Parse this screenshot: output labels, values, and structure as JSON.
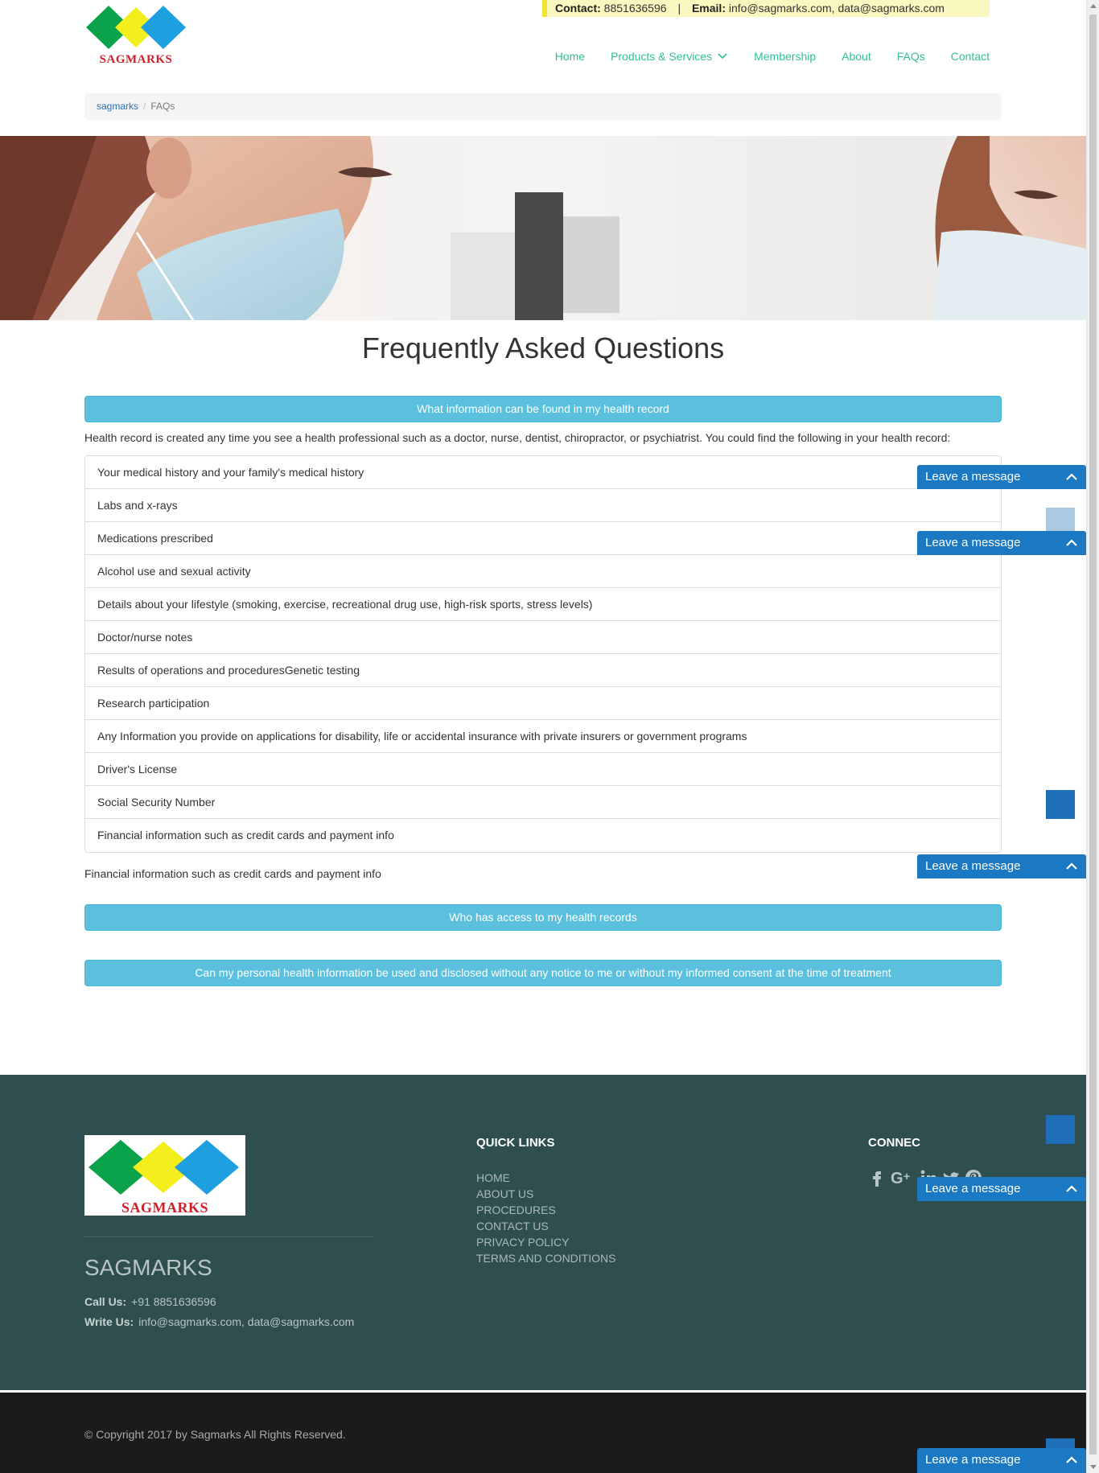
{
  "brand": {
    "logo_text": "SAGMARKS",
    "colors": {
      "green": "#0aa24a",
      "yellow": "#f4ee1c",
      "blue": "#1e9fe0",
      "red": "#d0202a"
    }
  },
  "contact_bar": {
    "contact_label": "Contact:",
    "contact_value": "8851636596",
    "separator": "|",
    "email_label": "Email:",
    "email_value": "info@sagmarks.com, data@sagmarks.com"
  },
  "nav": {
    "items": [
      {
        "label": "Home"
      },
      {
        "label": "Products & Services"
      },
      {
        "label": "Membership"
      },
      {
        "label": "About"
      },
      {
        "label": "FAQs"
      },
      {
        "label": "Contact"
      }
    ]
  },
  "breadcrumb": {
    "home": "sagmarks",
    "separator": "/",
    "current": "FAQs"
  },
  "page_title": "Frequently Asked Questions",
  "faq": {
    "q1": "What information can be found in my health record",
    "intro": "Health record is created any time you see a health professional such as a doctor, nurse, dentist, chiropractor, or psychiatrist. You could find the following in your health record:",
    "items": [
      "Your medical history and your family's medical history",
      "Labs and x-rays",
      "Medications prescribed",
      "Alcohol use and sexual activity",
      "Details about your lifestyle (smoking, exercise, recreational drug use, high-risk sports, stress levels)",
      "Doctor/nurse notes",
      "Results of operations and proceduresGenetic testing",
      "Research participation",
      "Any Information you provide on applications for disability, life or accidental insurance with private insurers or government programs",
      "Driver's License",
      "Social Security Number",
      "Financial information such as credit cards and payment info"
    ],
    "after_list": "Financial information such as credit cards and payment info",
    "q2": "Who has access to my health records",
    "q3": "Can my personal health information be used and disclosed without any notice to me or without my informed consent at the time of treatment"
  },
  "footer": {
    "brand": "SAGMARKS",
    "call_label": "Call Us:",
    "call_value": "+91 8851636596",
    "write_label": "Write Us:",
    "write_value": "info@sagmarks.com, data@sagmarks.com",
    "quick_links_title": "QUICK LINKS",
    "quick_links": [
      "HOME",
      "ABOUT US",
      "PROCEDURES",
      "CONTACT US",
      "PRIVACY POLICY",
      "TERMS AND CONDITIONS"
    ],
    "connect_title": "CONNEC",
    "social": [
      "facebook-icon",
      "google-plus-icon",
      "linkedin-icon",
      "twitter-icon",
      "pinterest-icon"
    ],
    "copyright": "© Copyright 2017 by Sagmarks All Rights Reserved."
  },
  "chat": {
    "label": "Leave a message"
  }
}
